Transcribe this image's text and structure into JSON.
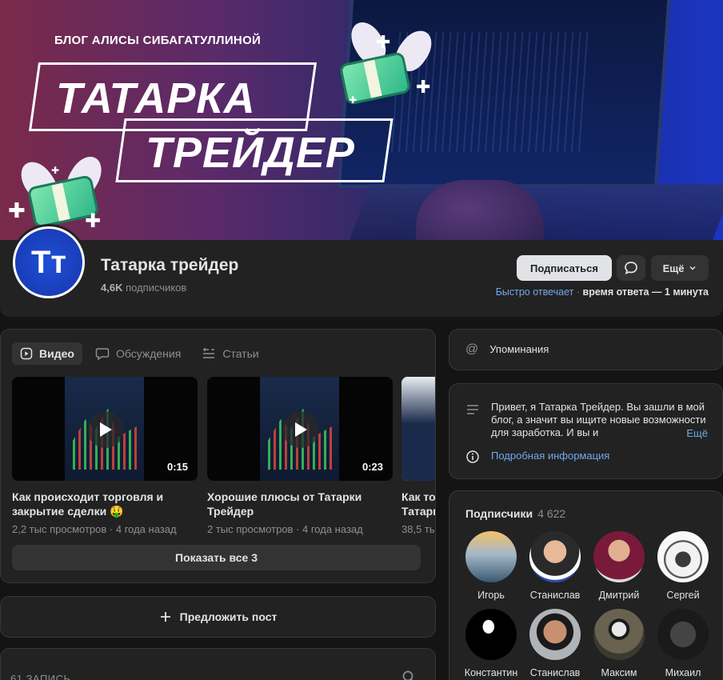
{
  "cover": {
    "blog_caption": "БЛОГ АЛИСЫ СИБАГАТУЛЛИНОЙ",
    "title_line1": "ТАТАРКА",
    "title_line2": "ТРЕЙДЕР"
  },
  "profile": {
    "avatar_text": "Тт",
    "name": "Татарка трейдер",
    "subscribers_count": "4,6K",
    "subscribers_label": "подписчиков",
    "subscribe_label": "Подписаться",
    "more_label": "Ещё",
    "response_fast": "Быстро отвечает",
    "response_sep": " · ",
    "response_time": "время ответа — 1 минута"
  },
  "media": {
    "tabs": [
      {
        "label": "Видео",
        "icon": "video-icon"
      },
      {
        "label": "Обсуждения",
        "icon": "chat-icon"
      },
      {
        "label": "Статьи",
        "icon": "article-icon"
      }
    ],
    "videos": [
      {
        "title_line1": "Как происходит торговля и",
        "title_line2": "закрытие сделки 🤑",
        "duration": "0:15",
        "meta": "2,2 тыс просмотров · 4 года назад"
      },
      {
        "title_line1": "Хорошие плюсы от Татарки",
        "title_line2": "Трейдер",
        "duration": "0:23",
        "meta": "2 тыс просмотров · 4 года назад"
      },
      {
        "title_line1": "Как то",
        "title_line2": "Татарк",
        "duration": "",
        "meta": "38,5 тыс"
      }
    ],
    "show_all_label": "Показать все 3"
  },
  "suggest_post_label": "Предложить пост",
  "feed": {
    "count_label": "61 ЗАПИСЬ"
  },
  "sidebar": {
    "mentions_label": "Упоминания",
    "about_text": "Привет, я Татарка Трейдер. Вы зашли в мой блог, а значит вы ищите новые возможности для заработка. И вы и",
    "about_more": "Ещё",
    "details_label": "Подробная информация"
  },
  "members": {
    "title": "Подписчики",
    "count": "4 622",
    "list": [
      {
        "name": "Игорь"
      },
      {
        "name": "Станислав"
      },
      {
        "name": "Дмитрий"
      },
      {
        "name": "Сергей"
      },
      {
        "name": "Константин"
      },
      {
        "name": "Станислав"
      },
      {
        "name": "Максим"
      },
      {
        "name": "Михаил"
      }
    ]
  },
  "colors": {
    "background": "#141414",
    "card": "#222222",
    "accent_link": "#71aaeb",
    "subscribe_button": "#e1e3e6"
  }
}
